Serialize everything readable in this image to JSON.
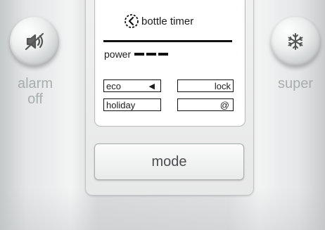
{
  "left_button": {
    "icon": "speaker-muted-icon",
    "label_line1": "alarm",
    "label_line2": "off"
  },
  "right_button": {
    "icon": "snowflake-icon",
    "label": "super"
  },
  "display": {
    "timer_icon": "bottle-timer-icon",
    "timer_label": "bottle timer",
    "power_label": "power",
    "power_level_bars": 3,
    "eco_label": "eco",
    "eco_arrow": "◀",
    "lock_label": "lock",
    "holiday_label": "holiday",
    "at_label": "@"
  },
  "mode_button": {
    "label": "mode"
  },
  "colors": {
    "side_label": "#a8adaf",
    "lcd_text": "#1c1c1c"
  }
}
